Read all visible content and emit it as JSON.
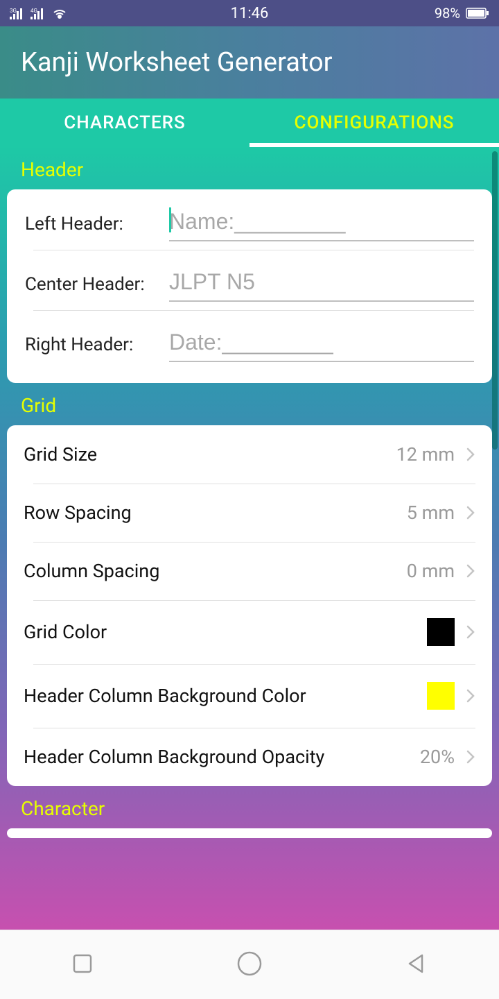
{
  "status": {
    "time": "11:46",
    "battery_pct": "98%"
  },
  "app": {
    "title": "Kanji Worksheet Generator"
  },
  "tabs": {
    "characters": "CHARACTERS",
    "configurations": "CONFIGURATIONS"
  },
  "sections": {
    "header": {
      "title": "Header",
      "left": {
        "label": "Left Header:",
        "placeholder": "Name:_________"
      },
      "center": {
        "label": "Center Header:",
        "placeholder": "JLPT N5"
      },
      "right": {
        "label": "Right Header:",
        "placeholder": "Date:_________"
      }
    },
    "grid": {
      "title": "Grid",
      "grid_size": {
        "label": "Grid Size",
        "value": "12 mm"
      },
      "row_spacing": {
        "label": "Row Spacing",
        "value": "5 mm"
      },
      "column_spacing": {
        "label": "Column Spacing",
        "value": "0 mm"
      },
      "grid_color": {
        "label": "Grid Color",
        "color": "#000000"
      },
      "header_bg_color": {
        "label": "Header Column Background Color",
        "color": "#ffff00"
      },
      "header_bg_opacity": {
        "label": "Header Column Background Opacity",
        "value": "20%"
      }
    },
    "character": {
      "title": "Character"
    }
  }
}
